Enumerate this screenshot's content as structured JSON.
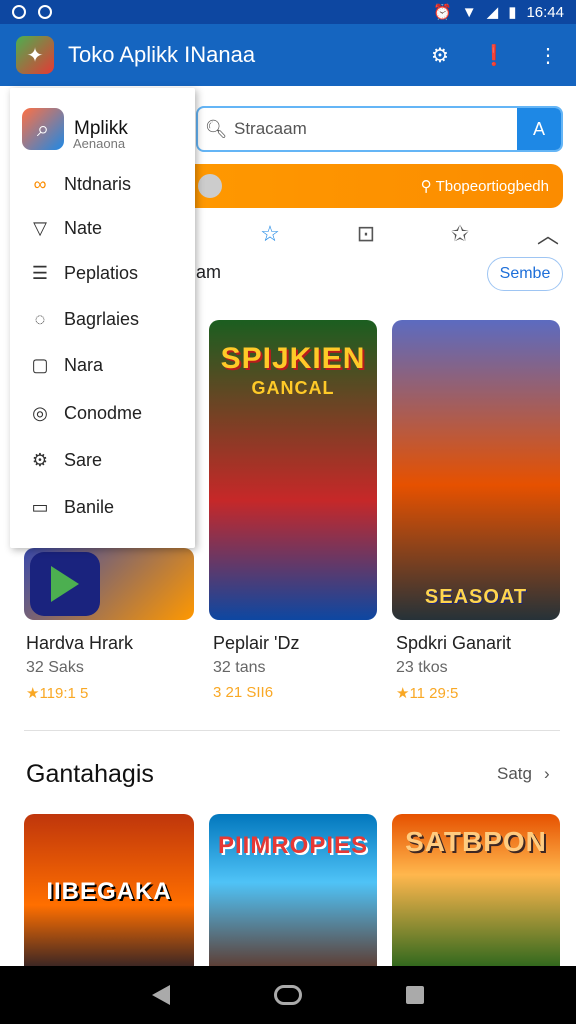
{
  "status_bar": {
    "time": "16:44"
  },
  "app_bar": {
    "title": "Toko Aplikk INanaa"
  },
  "search": {
    "placeholder": "Stracaam"
  },
  "promo_banner": {
    "text": "Tbopeortiogbedh"
  },
  "section1": {
    "partial_label": "am",
    "pill_label": "Sembe"
  },
  "featured_cards": [
    {
      "name": "Hardva Hrark",
      "sub": "32 Saks",
      "rating": "★119:1 5"
    },
    {
      "name": "Peplair 'Dz",
      "sub": "32 tans",
      "rating": "3 21 SII6",
      "art_title": "SPIJKIEN",
      "art_subtitle": "GANCAL"
    },
    {
      "name": "Spdkri Ganarit",
      "sub": "23 tkos",
      "rating": "★11 29:5",
      "art_title": "SEASOAT"
    }
  ],
  "section2": {
    "title": "Gantahagis",
    "see_all": "Satg",
    "cards": [
      {
        "art_title": "IIBEGAKA"
      },
      {
        "art_title": "PIIMROPIES"
      },
      {
        "art_title": "SATBPON"
      }
    ]
  },
  "drawer": {
    "app_name": "Mplikk",
    "app_sub": "Aenaona",
    "items": [
      {
        "label": "Ntdnaris",
        "icon": "link-icon"
      },
      {
        "label": "Nate",
        "icon": "shield-icon"
      },
      {
        "label": "Peplatios",
        "icon": "list-icon"
      },
      {
        "label": "Bagrlaies",
        "icon": "chat-icon"
      },
      {
        "label": "Nara",
        "icon": "box-icon"
      },
      {
        "label": "Conodme",
        "icon": "search-icon"
      },
      {
        "label": "Sare",
        "icon": "gear-icon"
      },
      {
        "label": "Banile",
        "icon": "info-icon"
      }
    ]
  },
  "colors": {
    "primary": "#1565c0",
    "status": "#0d47a1",
    "accent": "#fb8c00"
  }
}
